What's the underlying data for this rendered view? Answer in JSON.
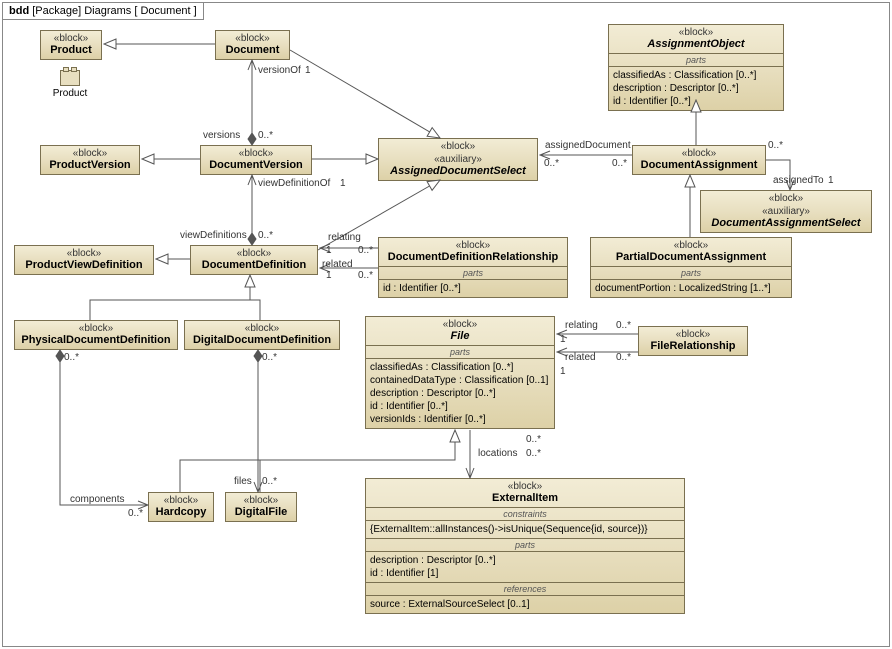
{
  "frame": {
    "kind": "bdd",
    "pkg": "[Package]",
    "name": "Diagrams",
    "scope": "[ Document ]"
  },
  "blocks": {
    "product": {
      "st": "«block»",
      "nm": "Product"
    },
    "document": {
      "st": "«block»",
      "nm": "Document"
    },
    "productVersion": {
      "st": "«block»",
      "nm": "ProductVersion"
    },
    "documentVersion": {
      "st": "«block»",
      "nm": "DocumentVersion"
    },
    "assignedDocumentSelect": {
      "st": "«block»",
      "aux": "«auxiliary»",
      "nm": "AssignedDocumentSelect"
    },
    "assignmentObject": {
      "st": "«block»",
      "nm": "AssignmentObject",
      "parts": [
        "classifiedAs : Classification [0..*]",
        "description : Descriptor [0..*]",
        "id : Identifier [0..*]"
      ]
    },
    "documentAssignment": {
      "st": "«block»",
      "nm": "DocumentAssignment"
    },
    "documentAssignmentSelect": {
      "st": "«block»",
      "aux": "«auxiliary»",
      "nm": "DocumentAssignmentSelect"
    },
    "productViewDefinition": {
      "st": "«block»",
      "nm": "ProductViewDefinition"
    },
    "documentDefinition": {
      "st": "«block»",
      "nm": "DocumentDefinition"
    },
    "documentDefinitionRelationship": {
      "st": "«block»",
      "nm": "DocumentDefinitionRelationship",
      "parts": [
        "id : Identifier [0..*]"
      ]
    },
    "partialDocumentAssignment": {
      "st": "«block»",
      "nm": "PartialDocumentAssignment",
      "parts": [
        "documentPortion : LocalizedString [1..*]"
      ]
    },
    "physicalDocumentDefinition": {
      "st": "«block»",
      "nm": "PhysicalDocumentDefinition"
    },
    "digitalDocumentDefinition": {
      "st": "«block»",
      "nm": "DigitalDocumentDefinition"
    },
    "file": {
      "st": "«block»",
      "nm": "File",
      "parts": [
        "classifiedAs : Classification [0..*]",
        "containedDataType : Classification [0..1]",
        "description : Descriptor [0..*]",
        "id : Identifier [0..*]",
        "versionIds : Identifier [0..*]"
      ]
    },
    "fileRelationship": {
      "st": "«block»",
      "nm": "FileRelationship"
    },
    "hardcopy": {
      "st": "«block»",
      "nm": "Hardcopy"
    },
    "digitalFile": {
      "st": "«block»",
      "nm": "DigitalFile"
    },
    "externalItem": {
      "st": "«block»",
      "nm": "ExternalItem",
      "constraints": [
        "{ExternalItem::allInstances()->isUnique(Sequence{id, source})}"
      ],
      "parts": [
        "description : Descriptor [0..*]",
        "id : Identifier [1]"
      ],
      "refs": [
        "source : ExternalSourceSelect [0..1]"
      ]
    }
  },
  "productIcon": "Product",
  "labels": {
    "versionOf": "versionOf",
    "one1": "1",
    "versions": "versions",
    "zm1": "0..*",
    "viewDefinitionOf": "viewDefinitionOf",
    "one2": "1",
    "viewDefinitions": "viewDefinitions",
    "zm2": "0..*",
    "relating": "relating",
    "related": "related",
    "zm3": "0..*",
    "one3": "1",
    "zm4": "0..*",
    "one4": "1",
    "assignedDocument": "assignedDocument",
    "zm5": "0..*",
    "zm6": "0..*",
    "assignedTo": "assignedTo",
    "one5": "1",
    "relating2": "relating",
    "related2": "related",
    "zm7": "0..*",
    "one6": "1",
    "zm8": "0..*",
    "one7": "1",
    "locations": "locations",
    "zm9": "0..*",
    "zm10": "0..*",
    "components": "components",
    "zm11": "0..*",
    "zm12": "0..*",
    "files": "files",
    "zm13": "0..*",
    "zm14": "0..*"
  },
  "sectionHeaders": {
    "parts": "parts",
    "constraints": "constraints",
    "references": "references"
  },
  "chart_data": {
    "type": "table",
    "description": "SysML Block Definition Diagram (BDD) for Document package",
    "blocks": [
      {
        "name": "Product",
        "stereotype": "block"
      },
      {
        "name": "Document",
        "stereotype": "block",
        "generalizes": "Product"
      },
      {
        "name": "ProductVersion",
        "stereotype": "block"
      },
      {
        "name": "DocumentVersion",
        "stereotype": "block",
        "generalizes": "ProductVersion"
      },
      {
        "name": "AssignedDocumentSelect",
        "stereotype": "block,auxiliary"
      },
      {
        "name": "AssignmentObject",
        "stereotype": "block",
        "parts": [
          "classifiedAs : Classification [0..*]",
          "description : Descriptor [0..*]",
          "id : Identifier [0..*]"
        ]
      },
      {
        "name": "DocumentAssignment",
        "stereotype": "block",
        "generalizes": "AssignmentObject"
      },
      {
        "name": "DocumentAssignmentSelect",
        "stereotype": "block,auxiliary"
      },
      {
        "name": "ProductViewDefinition",
        "stereotype": "block"
      },
      {
        "name": "DocumentDefinition",
        "stereotype": "block",
        "generalizes": "ProductViewDefinition"
      },
      {
        "name": "DocumentDefinitionRelationship",
        "stereotype": "block",
        "parts": [
          "id : Identifier [0..*]"
        ]
      },
      {
        "name": "PartialDocumentAssignment",
        "stereotype": "block",
        "generalizes": "DocumentAssignment",
        "parts": [
          "documentPortion : LocalizedString [1..*]"
        ]
      },
      {
        "name": "PhysicalDocumentDefinition",
        "stereotype": "block",
        "generalizes": "DocumentDefinition"
      },
      {
        "name": "DigitalDocumentDefinition",
        "stereotype": "block",
        "generalizes": "DocumentDefinition"
      },
      {
        "name": "File",
        "stereotype": "block",
        "parts": [
          "classifiedAs : Classification [0..*]",
          "containedDataType : Classification [0..1]",
          "description : Descriptor [0..*]",
          "id : Identifier [0..*]",
          "versionIds : Identifier [0..*]"
        ]
      },
      {
        "name": "FileRelationship",
        "stereotype": "block"
      },
      {
        "name": "Hardcopy",
        "stereotype": "block",
        "generalizes": "File"
      },
      {
        "name": "DigitalFile",
        "stereotype": "block",
        "generalizes": "File"
      },
      {
        "name": "ExternalItem",
        "stereotype": "block",
        "constraints": [
          "{ExternalItem::allInstances()->isUnique(Sequence{id, source})}"
        ],
        "parts": [
          "description : Descriptor [0..*]",
          "id : Identifier [1]"
        ],
        "references": [
          "source : ExternalSourceSelect [0..1]"
        ]
      }
    ],
    "associations": [
      {
        "from": "Document",
        "to": "DocumentVersion",
        "fromRole": "versionOf",
        "fromMult": "1",
        "toRole": "versions",
        "toMult": "0..*"
      },
      {
        "from": "DocumentVersion",
        "to": "DocumentDefinition",
        "fromRole": "viewDefinitionOf",
        "fromMult": "1",
        "toRole": "viewDefinitions",
        "toMult": "0..*"
      },
      {
        "from": "DocumentVersion",
        "to": "AssignedDocumentSelect",
        "type": "realization"
      },
      {
        "from": "Document",
        "to": "AssignedDocumentSelect",
        "type": "realization"
      },
      {
        "from": "DocumentDefinition",
        "to": "AssignedDocumentSelect",
        "type": "realization"
      },
      {
        "from": "DocumentDefinitionRelationship",
        "to": "DocumentDefinition",
        "role": "relating",
        "mult": "0..* / 1"
      },
      {
        "from": "DocumentDefinitionRelationship",
        "to": "DocumentDefinition",
        "role": "related",
        "mult": "0..* / 1"
      },
      {
        "from": "DocumentAssignment",
        "to": "AssignedDocumentSelect",
        "role": "assignedDocument",
        "mult": "0..* / 0..*"
      },
      {
        "from": "DocumentAssignment",
        "to": "DocumentAssignmentSelect",
        "role": "assignedTo",
        "mult": "1"
      },
      {
        "from": "FileRelationship",
        "to": "File",
        "role": "relating",
        "mult": "0..* / 1"
      },
      {
        "from": "FileRelationship",
        "to": "File",
        "role": "related",
        "mult": "0..* / 1"
      },
      {
        "from": "File",
        "to": "ExternalItem",
        "role": "locations",
        "mult": "0..* / 0..*"
      },
      {
        "from": "PhysicalDocumentDefinition",
        "to": "Hardcopy",
        "role": "components",
        "mult": "0..* / 0..*"
      },
      {
        "from": "DigitalDocumentDefinition",
        "to": "DigitalFile",
        "role": "files",
        "mult": "0..* / 0..*"
      }
    ]
  }
}
